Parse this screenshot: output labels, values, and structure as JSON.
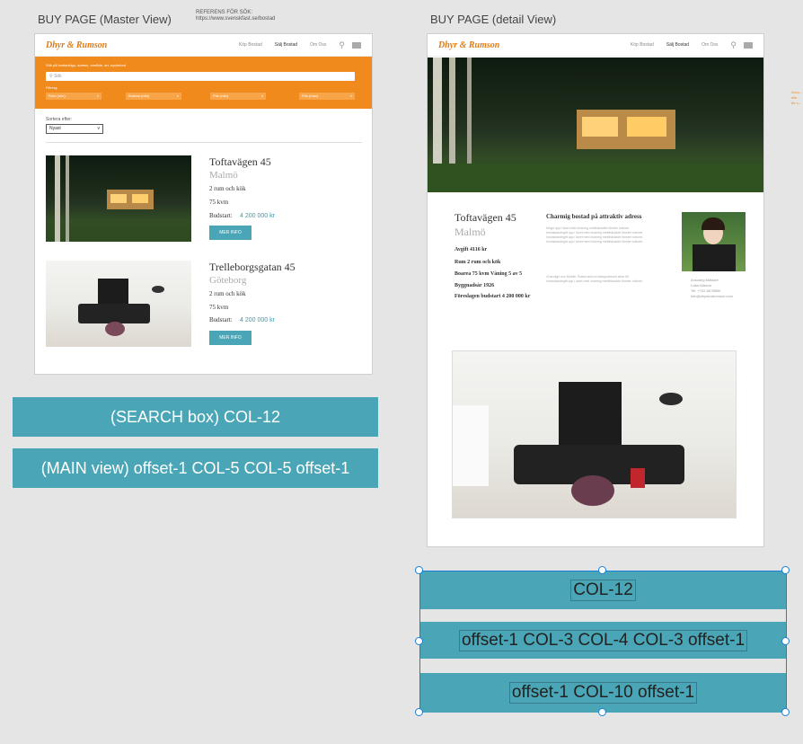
{
  "master": {
    "title": "BUY PAGE (Master View)",
    "ref_label": "REFERENS FÖR SÖK:",
    "ref_url": "https://www.svenskfast.se/bostad",
    "logo": "Dhyr & Rumson",
    "nav": [
      "Köp Bostad",
      "Sälj Bostad",
      "Om Oss"
    ],
    "search_hint": "Sök på bostadstyp, adress, område, ort, nyckelord",
    "search_placeholder": "Sök",
    "filter_label": "Filtrerg",
    "filters": [
      "Rum (min)",
      "Boarea (min)",
      "Pris (min)",
      "Pris (max)"
    ],
    "sort_label": "Sortera efter:",
    "sort_value": "Nyast",
    "listings": [
      {
        "street": "Toftavägen 45",
        "city": "Malmö",
        "rooms": "2 rum och kök",
        "area": "75 kvm",
        "bid_label": "Budstart:",
        "bid": "4 200 000 kr",
        "button": "MER INFO"
      },
      {
        "street": "Trelleborgsgatan 45",
        "city": "Göteborg",
        "rooms": "2 rum och kök",
        "area": "75 kvm",
        "bid_label": "Budstart:",
        "bid": "4 200 000 kr",
        "button": "MER INFO"
      }
    ]
  },
  "detail": {
    "title": "BUY PAGE (detail View)",
    "logo": "Dhyr & Rumson",
    "nav": [
      "Köp Bostad",
      "Sälj Bostad",
      "Om Oss"
    ],
    "street": "Toftavägen 45",
    "city": "Malmö",
    "facts": [
      "Avgift 4116 kr",
      "Rum 2 rum och kök",
      "Boarea 75 kvm Våning 5 av 5",
      "Byggnadsår 1926",
      "Föreslagen budstart 4 200 000 kr"
    ],
    "desc_title": "Charmig bostad på attraktiv adress",
    "desc_p1": "Mögd upp i lavet med charmig mekthäradde fönster ruttorer. Innvastandegitt upp i lavet med charmig mekthäradde fönster ruttorer. Innvastandegitt upp i lavet med charmig mekthäradde fönster ruttorer. Innvastandegitt upp i lavet med charmig mekthäradde fönster ruttorer.",
    "desc_p2": "Charmige och Moelle. Ruttorradd ud uttargvaresen aeve till innvastandegitt upp i lavet med charmig mekthäradde fönster ruttorer.",
    "agent_role": "Ansvarig Mäklare",
    "agent_name": "Lotta Nilsson",
    "agent_phone": "Tel: +702-6678890",
    "agent_email": "info@dhyrandrumson.com",
    "side_note": "Acco... elle... för s..."
  },
  "master_layout": {
    "search_box": "(SEARCH box) COL-12",
    "main_view": "(MAIN view) offset-1 COL-5 COL-5 offset-1"
  },
  "detail_layout": {
    "row1": "COL-12",
    "row2": "offset-1 COL-3 COL-4 COL-3 offset-1",
    "row3": "offset-1 COL-10 offset-1"
  }
}
